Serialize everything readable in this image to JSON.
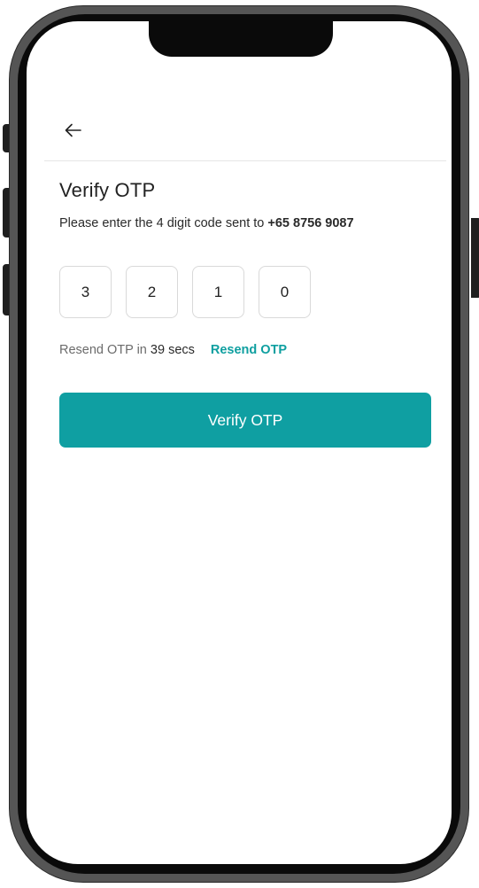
{
  "header": {
    "back_icon": "arrow-left-icon"
  },
  "otp": {
    "title": "Verify OTP",
    "instruction": "Please enter the 4 digit code sent to",
    "phone_number": "+65 8756 9087",
    "digits": [
      "3",
      "2",
      "1",
      "0"
    ],
    "resend_prefix": "Resend OTP in",
    "countdown": "39 secs",
    "resend_link": "Resend OTP",
    "verify_button": "Verify OTP"
  },
  "colors": {
    "accent": "#0f9fa2",
    "link": "#0e9fa0",
    "text_primary": "#222222",
    "text_muted": "#6b6b6b",
    "box_border": "#d9d9d9"
  }
}
